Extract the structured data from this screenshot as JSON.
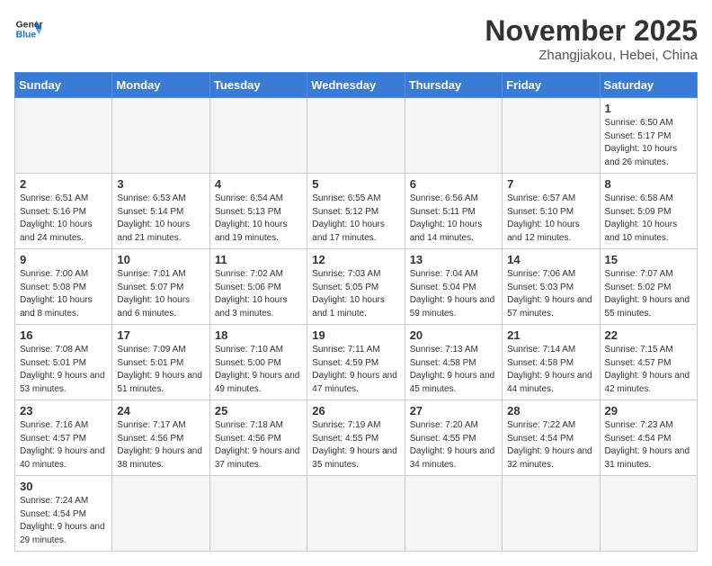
{
  "logo": {
    "text_general": "General",
    "text_blue": "Blue"
  },
  "title": "November 2025",
  "subtitle": "Zhangjiakou, Hebei, China",
  "days_of_week": [
    "Sunday",
    "Monday",
    "Tuesday",
    "Wednesday",
    "Thursday",
    "Friday",
    "Saturday"
  ],
  "weeks": [
    [
      {
        "day": "",
        "info": ""
      },
      {
        "day": "",
        "info": ""
      },
      {
        "day": "",
        "info": ""
      },
      {
        "day": "",
        "info": ""
      },
      {
        "day": "",
        "info": ""
      },
      {
        "day": "",
        "info": ""
      },
      {
        "day": "1",
        "info": "Sunrise: 6:50 AM\nSunset: 5:17 PM\nDaylight: 10 hours and 26 minutes."
      }
    ],
    [
      {
        "day": "2",
        "info": "Sunrise: 6:51 AM\nSunset: 5:16 PM\nDaylight: 10 hours and 24 minutes."
      },
      {
        "day": "3",
        "info": "Sunrise: 6:53 AM\nSunset: 5:14 PM\nDaylight: 10 hours and 21 minutes."
      },
      {
        "day": "4",
        "info": "Sunrise: 6:54 AM\nSunset: 5:13 PM\nDaylight: 10 hours and 19 minutes."
      },
      {
        "day": "5",
        "info": "Sunrise: 6:55 AM\nSunset: 5:12 PM\nDaylight: 10 hours and 17 minutes."
      },
      {
        "day": "6",
        "info": "Sunrise: 6:56 AM\nSunset: 5:11 PM\nDaylight: 10 hours and 14 minutes."
      },
      {
        "day": "7",
        "info": "Sunrise: 6:57 AM\nSunset: 5:10 PM\nDaylight: 10 hours and 12 minutes."
      },
      {
        "day": "8",
        "info": "Sunrise: 6:58 AM\nSunset: 5:09 PM\nDaylight: 10 hours and 10 minutes."
      }
    ],
    [
      {
        "day": "9",
        "info": "Sunrise: 7:00 AM\nSunset: 5:08 PM\nDaylight: 10 hours and 8 minutes."
      },
      {
        "day": "10",
        "info": "Sunrise: 7:01 AM\nSunset: 5:07 PM\nDaylight: 10 hours and 6 minutes."
      },
      {
        "day": "11",
        "info": "Sunrise: 7:02 AM\nSunset: 5:06 PM\nDaylight: 10 hours and 3 minutes."
      },
      {
        "day": "12",
        "info": "Sunrise: 7:03 AM\nSunset: 5:05 PM\nDaylight: 10 hours and 1 minute."
      },
      {
        "day": "13",
        "info": "Sunrise: 7:04 AM\nSunset: 5:04 PM\nDaylight: 9 hours and 59 minutes."
      },
      {
        "day": "14",
        "info": "Sunrise: 7:06 AM\nSunset: 5:03 PM\nDaylight: 9 hours and 57 minutes."
      },
      {
        "day": "15",
        "info": "Sunrise: 7:07 AM\nSunset: 5:02 PM\nDaylight: 9 hours and 55 minutes."
      }
    ],
    [
      {
        "day": "16",
        "info": "Sunrise: 7:08 AM\nSunset: 5:01 PM\nDaylight: 9 hours and 53 minutes."
      },
      {
        "day": "17",
        "info": "Sunrise: 7:09 AM\nSunset: 5:01 PM\nDaylight: 9 hours and 51 minutes."
      },
      {
        "day": "18",
        "info": "Sunrise: 7:10 AM\nSunset: 5:00 PM\nDaylight: 9 hours and 49 minutes."
      },
      {
        "day": "19",
        "info": "Sunrise: 7:11 AM\nSunset: 4:59 PM\nDaylight: 9 hours and 47 minutes."
      },
      {
        "day": "20",
        "info": "Sunrise: 7:13 AM\nSunset: 4:58 PM\nDaylight: 9 hours and 45 minutes."
      },
      {
        "day": "21",
        "info": "Sunrise: 7:14 AM\nSunset: 4:58 PM\nDaylight: 9 hours and 44 minutes."
      },
      {
        "day": "22",
        "info": "Sunrise: 7:15 AM\nSunset: 4:57 PM\nDaylight: 9 hours and 42 minutes."
      }
    ],
    [
      {
        "day": "23",
        "info": "Sunrise: 7:16 AM\nSunset: 4:57 PM\nDaylight: 9 hours and 40 minutes."
      },
      {
        "day": "24",
        "info": "Sunrise: 7:17 AM\nSunset: 4:56 PM\nDaylight: 9 hours and 38 minutes."
      },
      {
        "day": "25",
        "info": "Sunrise: 7:18 AM\nSunset: 4:56 PM\nDaylight: 9 hours and 37 minutes."
      },
      {
        "day": "26",
        "info": "Sunrise: 7:19 AM\nSunset: 4:55 PM\nDaylight: 9 hours and 35 minutes."
      },
      {
        "day": "27",
        "info": "Sunrise: 7:20 AM\nSunset: 4:55 PM\nDaylight: 9 hours and 34 minutes."
      },
      {
        "day": "28",
        "info": "Sunrise: 7:22 AM\nSunset: 4:54 PM\nDaylight: 9 hours and 32 minutes."
      },
      {
        "day": "29",
        "info": "Sunrise: 7:23 AM\nSunset: 4:54 PM\nDaylight: 9 hours and 31 minutes."
      }
    ],
    [
      {
        "day": "30",
        "info": "Sunrise: 7:24 AM\nSunset: 4:54 PM\nDaylight: 9 hours and 29 minutes."
      },
      {
        "day": "",
        "info": ""
      },
      {
        "day": "",
        "info": ""
      },
      {
        "day": "",
        "info": ""
      },
      {
        "day": "",
        "info": ""
      },
      {
        "day": "",
        "info": ""
      },
      {
        "day": "",
        "info": ""
      }
    ]
  ]
}
